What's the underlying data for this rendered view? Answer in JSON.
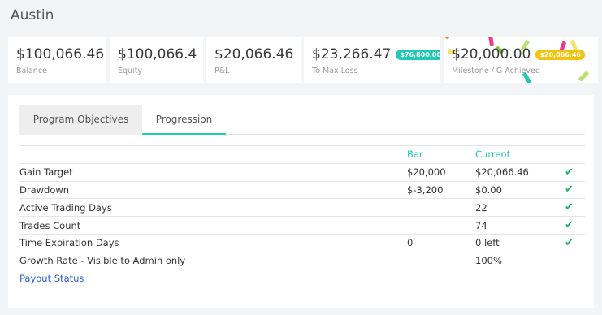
{
  "page": {
    "title": "Austin"
  },
  "stats": [
    {
      "value": "$100,066.46",
      "label": "Balance"
    },
    {
      "value": "$100,066.4",
      "label": "Equity"
    },
    {
      "value": "$20,066.46",
      "label": "P&L"
    },
    {
      "value": "$23,266.47",
      "label": "To Max Loss",
      "badge": "$76,800.00"
    },
    {
      "value": "$20,000.00",
      "label": "Milestone / G Achieved",
      "badge": "$20,066.46"
    }
  ],
  "tabs": [
    {
      "label": "Program Objectives"
    },
    {
      "label": "Progression"
    }
  ],
  "table": {
    "headers": {
      "bar": "Bar",
      "current": "Current"
    },
    "rows": [
      {
        "name": "Gain Target",
        "bar": "$20,000",
        "current": "$20,066.46",
        "check": "✔"
      },
      {
        "name": "Drawdown",
        "bar": "$-3,200",
        "current": "$0.00",
        "check": "✔"
      },
      {
        "name": "Active Trading Days",
        "bar": "",
        "current": "22",
        "check": "✔"
      },
      {
        "name": "Trades Count",
        "bar": "",
        "current": "74",
        "check": "✔"
      },
      {
        "name": "Time Expiration Days",
        "bar": "0",
        "current": "0 left",
        "check": "✔"
      },
      {
        "name": "Growth Rate - Visible to Admin only",
        "bar": "",
        "current": "100%",
        "check": ""
      }
    ],
    "footer_link": "Payout Status"
  },
  "colors": {
    "accent": "#1fc9b2",
    "badge_yellow": "#f4c20d",
    "check": "#22b573",
    "link": "#2e5fd6"
  }
}
